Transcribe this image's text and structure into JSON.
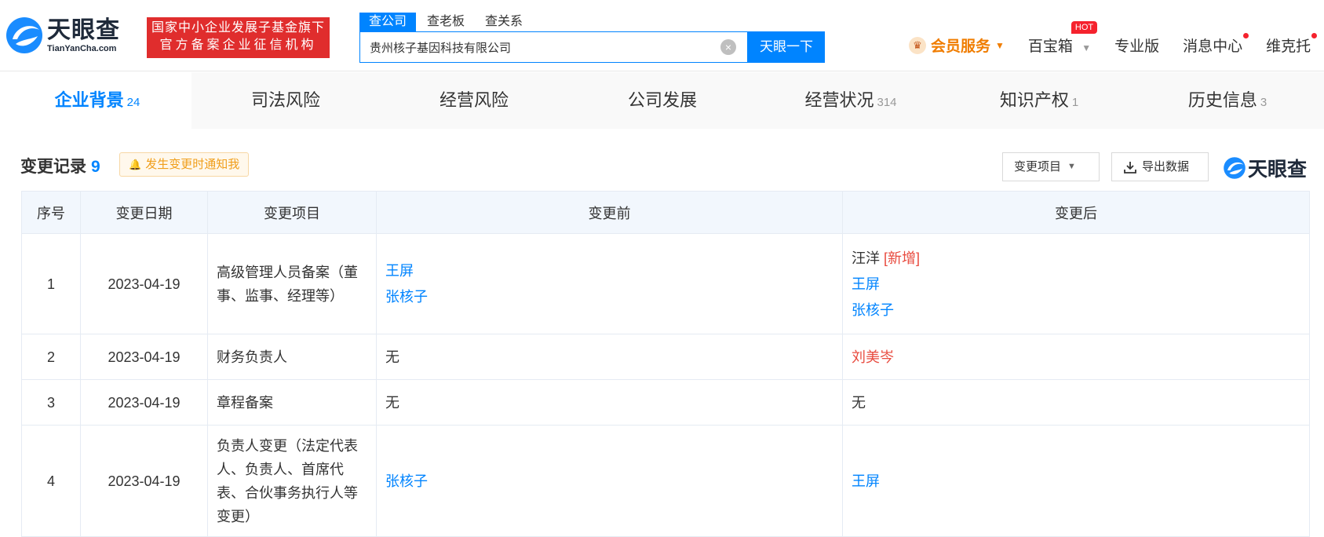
{
  "header": {
    "logo_cn": "天眼查",
    "logo_en": "TianYanCha.com",
    "badge_line1": "国家中小企业发展子基金旗下",
    "badge_line2": "官方备案企业征信机构",
    "search_tabs": [
      "查公司",
      "查老板",
      "查关系"
    ],
    "search_value": "贵州核子基因科技有限公司",
    "search_button": "天眼一下",
    "member_label": "会员服务",
    "nav": {
      "treasure": "百宝箱",
      "hot": "HOT",
      "pro": "专业版",
      "messages": "消息中心",
      "user": "维克托"
    }
  },
  "main_tabs": [
    {
      "label": "企业背景",
      "count": "24"
    },
    {
      "label": "司法风险",
      "count": ""
    },
    {
      "label": "经营风险",
      "count": ""
    },
    {
      "label": "公司发展",
      "count": ""
    },
    {
      "label": "经营状况",
      "count": "314"
    },
    {
      "label": "知识产权",
      "count": "1"
    },
    {
      "label": "历史信息",
      "count": "3"
    }
  ],
  "section": {
    "title": "变更记录",
    "count": "9",
    "notify": "发生变更时通知我",
    "filter_button": "变更项目",
    "export_button": "导出数据",
    "watermark": "天眼查"
  },
  "table": {
    "headers": [
      "序号",
      "变更日期",
      "变更项目",
      "变更前",
      "变更后"
    ],
    "rows": [
      {
        "no": "1",
        "date": "2023-04-19",
        "item": "高级管理人员备案（董事、监事、经理等）",
        "before": [
          "王屏",
          "张核子"
        ],
        "after_new": "汪洋",
        "after_new_tag": "[新增]",
        "after": [
          "王屏",
          "张核子"
        ]
      },
      {
        "no": "2",
        "date": "2023-04-19",
        "item": "财务负责人",
        "before_text": "无",
        "after_red": "刘美岑"
      },
      {
        "no": "3",
        "date": "2023-04-19",
        "item": "章程备案",
        "before_text": "无",
        "after_text": "无"
      },
      {
        "no": "4",
        "date": "2023-04-19",
        "item": "负责人变更（法定代表人、负责人、首席代表、合伙事务执行人等变更）",
        "before_link": "张核子",
        "after_link": "王屏"
      }
    ]
  },
  "colors": {
    "brand_blue": "#0084ff",
    "badge_red": "#e02d2d",
    "member_orange": "#f07d00",
    "highlight_red": "#e84a3e"
  }
}
